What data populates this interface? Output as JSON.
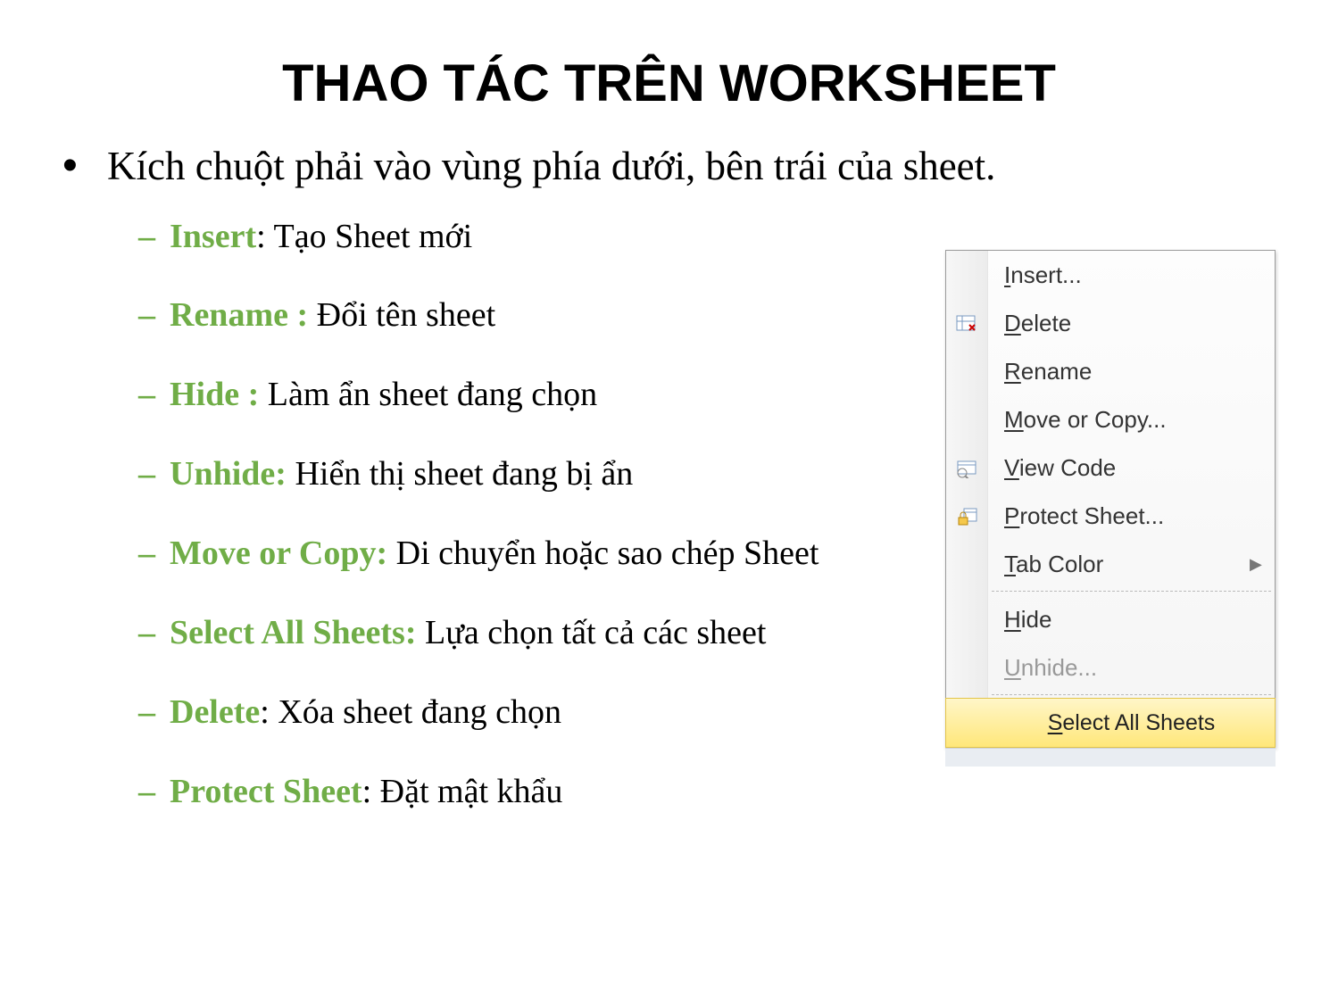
{
  "title": "THAO TÁC TRÊN WORKSHEET",
  "intro": "Kích chuột phải vào vùng phía dưới, bên trái của sheet.",
  "items": [
    {
      "term": "Insert",
      "sep": ": ",
      "desc": "Tạo Sheet mới"
    },
    {
      "term": "Rename ",
      "sep": ": ",
      "desc": "Đổi tên sheet"
    },
    {
      "term": "Hide ",
      "sep": ": ",
      "desc": "Làm ẩn sheet đang chọn"
    },
    {
      "term": "Unhide",
      "sep": ": ",
      "desc": "Hiển thị sheet đang bị ẩn"
    },
    {
      "term": "Move or Copy",
      "sep": ": ",
      "desc": "Di chuyển hoặc sao chép Sheet"
    },
    {
      "term": "Select All Sheets",
      "sep": ": ",
      "desc": "Lựa chọn tất cả các sheet"
    },
    {
      "term": "Delete",
      "sep": ": ",
      "desc": "Xóa sheet đang chọn"
    },
    {
      "term": "Protect Sheet",
      "sep": ": ",
      "desc": "Đặt mật khẩu"
    }
  ],
  "menu": {
    "insert": {
      "pre": "",
      "u": "I",
      "post": "nsert..."
    },
    "delete": {
      "pre": "",
      "u": "D",
      "post": "elete"
    },
    "rename": {
      "pre": "",
      "u": "R",
      "post": "ename"
    },
    "moveorcopy": {
      "pre": "",
      "u": "M",
      "post": "ove or Copy..."
    },
    "viewcode": {
      "pre": "",
      "u": "V",
      "post": "iew Code"
    },
    "protectsheet": {
      "pre": "",
      "u": "P",
      "post": "rotect Sheet..."
    },
    "tabcolor": {
      "pre": "",
      "u": "T",
      "post": "ab Color"
    },
    "hide": {
      "pre": "",
      "u": "H",
      "post": "ide"
    },
    "unhide": {
      "pre": "",
      "u": "U",
      "post": "nhide..."
    },
    "selectall": {
      "pre": "",
      "u": "S",
      "post": "elect All Sheets"
    }
  }
}
